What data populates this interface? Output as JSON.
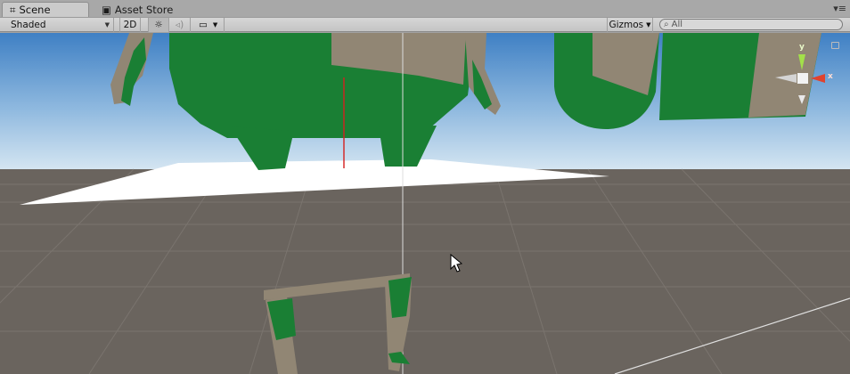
{
  "tabs": [
    {
      "label": "Scene",
      "icon": "grid-icon"
    },
    {
      "label": "Asset Store",
      "icon": "store-bag-icon"
    }
  ],
  "tab_menu_icon": "tab-menu-icon",
  "toolbar": {
    "draw_mode": "Shaded",
    "mode_2d": "2D",
    "lighting_icon": "sun-icon",
    "audio_icon": "speaker-icon",
    "effects_icon": "image-icon",
    "gizmos_label": "Gizmos",
    "search_placeholder": "All",
    "search_icon": "search-icon"
  },
  "orientation_gizmo": {
    "y_label": "y",
    "x_label": "x"
  },
  "colors": {
    "sky_top": "#4a87c8",
    "sky_bottom": "#cbe0f0",
    "ground": "#6c6660",
    "model_green": "#1a7f34",
    "model_tan": "#918674",
    "gizmo_y": "#a3e04a",
    "gizmo_x": "#e0422e"
  }
}
